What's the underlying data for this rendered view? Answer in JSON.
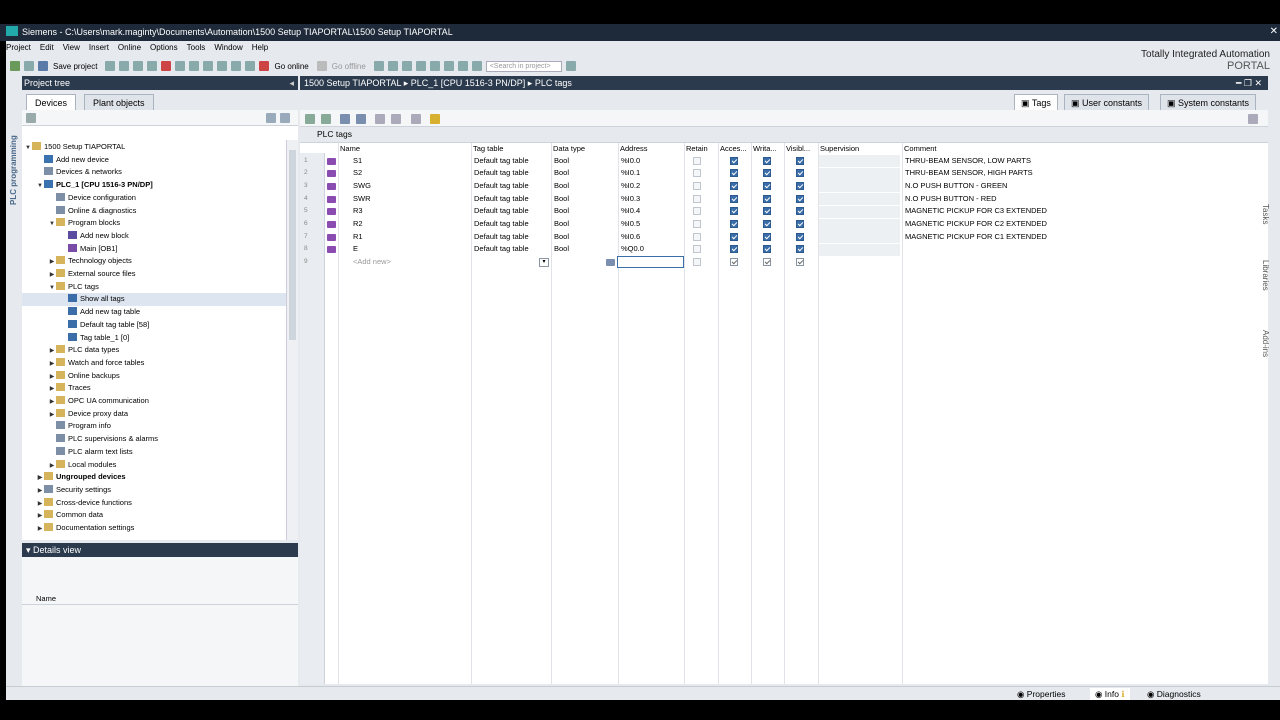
{
  "window": {
    "title": "Siemens  -  C:\\Users\\mark.maginty\\Documents\\Automation\\1500 Setup TIAPORTAL\\1500 Setup TIAPORTAL",
    "brand_line1": "Totally Integrated Automation",
    "brand_line2": "PORTAL"
  },
  "menu": [
    "Project",
    "Edit",
    "View",
    "Insert",
    "Online",
    "Options",
    "Tools",
    "Window",
    "Help"
  ],
  "toolbar": {
    "save_label": "Save project",
    "go_online": "Go online",
    "go_offline": "Go offline",
    "search_placeholder": "<Search in project>"
  },
  "side_tab": "PLC programming",
  "project_tree": {
    "title": "Project tree",
    "tabs": [
      "Devices",
      "Plant objects"
    ],
    "items": [
      {
        "label": "1500 Setup TIAPORTAL",
        "indent": 0,
        "arrow": "open",
        "icon": "folder-icon"
      },
      {
        "label": "Add new device",
        "indent": 1,
        "arrow": "",
        "icon": "add-device-icon"
      },
      {
        "label": "Devices & networks",
        "indent": 1,
        "arrow": "",
        "icon": "network-icon"
      },
      {
        "label": "PLC_1 [CPU 1516-3 PN/DP]",
        "indent": 1,
        "arrow": "open",
        "icon": "plc-icon",
        "bold": true
      },
      {
        "label": "Device configuration",
        "indent": 2,
        "arrow": "",
        "icon": "device-config-icon"
      },
      {
        "label": "Online & diagnostics",
        "indent": 2,
        "arrow": "",
        "icon": "diagnostics-icon"
      },
      {
        "label": "Program blocks",
        "indent": 2,
        "arrow": "open",
        "icon": "folder-icon"
      },
      {
        "label": "Add new block",
        "indent": 3,
        "arrow": "",
        "icon": "add-block-icon"
      },
      {
        "label": "Main [OB1]",
        "indent": 3,
        "arrow": "",
        "icon": "ob-block-icon"
      },
      {
        "label": "Technology objects",
        "indent": 2,
        "arrow": "closed",
        "icon": "folder-icon"
      },
      {
        "label": "External source files",
        "indent": 2,
        "arrow": "closed",
        "icon": "folder-icon"
      },
      {
        "label": "PLC tags",
        "indent": 2,
        "arrow": "open",
        "icon": "folder-icon"
      },
      {
        "label": "Show all tags",
        "indent": 3,
        "arrow": "",
        "icon": "tag-table-icon",
        "selected": true
      },
      {
        "label": "Add new tag table",
        "indent": 3,
        "arrow": "",
        "icon": "add-tag-table-icon"
      },
      {
        "label": "Default tag table [58]",
        "indent": 3,
        "arrow": "",
        "icon": "tag-table-icon"
      },
      {
        "label": "Tag table_1 [0]",
        "indent": 3,
        "arrow": "",
        "icon": "tag-table-icon"
      },
      {
        "label": "PLC data types",
        "indent": 2,
        "arrow": "closed",
        "icon": "folder-icon"
      },
      {
        "label": "Watch and force tables",
        "indent": 2,
        "arrow": "closed",
        "icon": "folder-icon"
      },
      {
        "label": "Online backups",
        "indent": 2,
        "arrow": "closed",
        "icon": "folder-icon"
      },
      {
        "label": "Traces",
        "indent": 2,
        "arrow": "closed",
        "icon": "folder-icon"
      },
      {
        "label": "OPC UA communication",
        "indent": 2,
        "arrow": "closed",
        "icon": "folder-icon"
      },
      {
        "label": "Device proxy data",
        "indent": 2,
        "arrow": "closed",
        "icon": "folder-icon"
      },
      {
        "label": "Program info",
        "indent": 2,
        "arrow": "",
        "icon": "info-icon"
      },
      {
        "label": "PLC supervisions & alarms",
        "indent": 2,
        "arrow": "",
        "icon": "alarm-icon"
      },
      {
        "label": "PLC alarm text lists",
        "indent": 2,
        "arrow": "",
        "icon": "text-list-icon"
      },
      {
        "label": "Local modules",
        "indent": 2,
        "arrow": "closed",
        "icon": "folder-icon"
      },
      {
        "label": "Ungrouped devices",
        "indent": 1,
        "arrow": "closed",
        "icon": "folder-icon",
        "bold": true
      },
      {
        "label": "Security settings",
        "indent": 1,
        "arrow": "closed",
        "icon": "security-icon"
      },
      {
        "label": "Cross-device functions",
        "indent": 1,
        "arrow": "closed",
        "icon": "folder-icon"
      },
      {
        "label": "Common data",
        "indent": 1,
        "arrow": "closed",
        "icon": "folder-icon"
      },
      {
        "label": "Documentation settings",
        "indent": 1,
        "arrow": "closed",
        "icon": "folder-icon"
      }
    ]
  },
  "details_view": {
    "title": "Details view",
    "column": "Name"
  },
  "editor": {
    "breadcrumb": "1500 Setup TIAPORTAL  ▸  PLC_1 [CPU 1516-3 PN/DP]  ▸  PLC tags",
    "tabs": [
      "Tags",
      "User constants",
      "System constants"
    ],
    "section_title": "PLC tags",
    "columns": [
      "Name",
      "Tag table",
      "Data type",
      "Address",
      "Retain",
      "Acces...",
      "Writa...",
      "Visibl...",
      "Supervision",
      "Comment"
    ],
    "rows": [
      {
        "n": "1",
        "name": "S1",
        "table": "Default tag table",
        "type": "Bool",
        "address": "%I0.0",
        "comment": "THRU-BEAM SENSOR, LOW PARTS"
      },
      {
        "n": "2",
        "name": "S2",
        "table": "Default tag table",
        "type": "Bool",
        "address": "%I0.1",
        "comment": "THRU-BEAM SENSOR, HIGH PARTS"
      },
      {
        "n": "3",
        "name": "SWG",
        "table": "Default tag table",
        "type": "Bool",
        "address": "%I0.2",
        "comment": "N.O PUSH BUTTON - GREEN"
      },
      {
        "n": "4",
        "name": "SWR",
        "table": "Default tag table",
        "type": "Bool",
        "address": "%I0.3",
        "comment": "N.O PUSH BUTTON - RED"
      },
      {
        "n": "5",
        "name": "R3",
        "table": "Default tag table",
        "type": "Bool",
        "address": "%I0.4",
        "comment": "MAGNETIC PICKUP FOR C3 EXTENDED"
      },
      {
        "n": "6",
        "name": "R2",
        "table": "Default tag table",
        "type": "Bool",
        "address": "%I0.5",
        "comment": "MAGNETIC PICKUP FOR C2 EXTENDED"
      },
      {
        "n": "7",
        "name": "R1",
        "table": "Default tag table",
        "type": "Bool",
        "address": "%I0.6",
        "comment": "MAGNETIC PICKUP FOR C1 EXTENDED"
      },
      {
        "n": "8",
        "name": "E",
        "table": "Default tag table",
        "type": "Bool",
        "address": "%Q0.0",
        "comment": ""
      }
    ],
    "new_row": {
      "n": "9",
      "placeholder": "<Add new>"
    }
  },
  "right_tabs": [
    "Tasks",
    "Libraries",
    "Add-ins"
  ],
  "status_tabs": [
    "Properties",
    "Info",
    "Diagnostics"
  ]
}
